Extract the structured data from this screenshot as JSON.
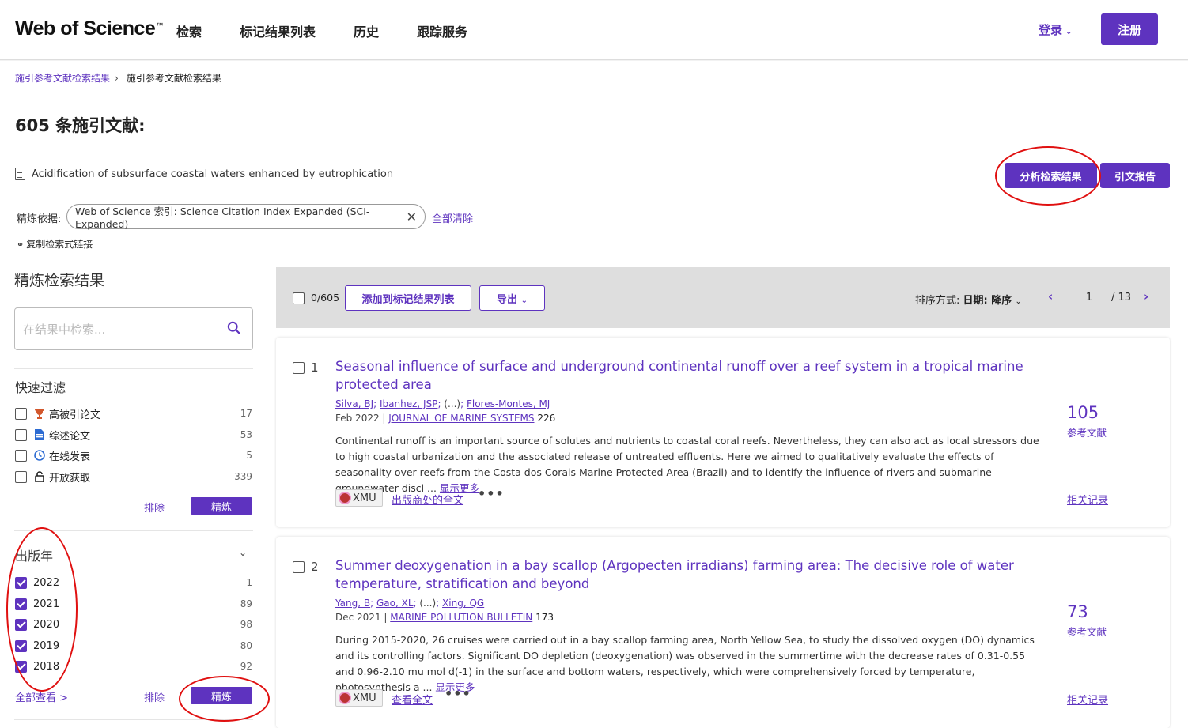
{
  "header": {
    "logo": "Web of Science",
    "logo_tm": "™",
    "nav": [
      "检索",
      "标记结果列表",
      "历史",
      "跟踪服务"
    ],
    "login_label": "登录",
    "register_label": "注册"
  },
  "breadcrumb": {
    "link": "施引参考文献检索结果",
    "current": "施引参考文献检索结果"
  },
  "page_title": "605 条施引文献:",
  "cited_paper": "Acidification of subsurface coastal waters enhanced by eutrophication",
  "actions": {
    "analyze": "分析检索结果",
    "citation_report": "引文报告"
  },
  "refine": {
    "label": "精炼依据:",
    "chip": "Web of Science 索引: Science Citation Index Expanded (SCI-Expanded)",
    "clear_all": "全部清除",
    "copy_link": "复制检索式链接"
  },
  "sidebar": {
    "title": "精炼检索结果",
    "search_placeholder": "在结果中检索...",
    "quick_filter": {
      "title": "快速过滤",
      "items": [
        {
          "label": "高被引论文",
          "count": "17",
          "icon": "trophy-icon"
        },
        {
          "label": "综述论文",
          "count": "53",
          "icon": "document-icon"
        },
        {
          "label": "在线发表",
          "count": "5",
          "icon": "clock-icon"
        },
        {
          "label": "开放获取",
          "count": "339",
          "icon": "lock-icon"
        }
      ],
      "exclude": "排除",
      "refine": "精炼"
    },
    "pub_year": {
      "title": "出版年",
      "items": [
        {
          "label": "2022",
          "count": "1",
          "checked": true
        },
        {
          "label": "2021",
          "count": "89",
          "checked": true
        },
        {
          "label": "2020",
          "count": "98",
          "checked": true
        },
        {
          "label": "2019",
          "count": "80",
          "checked": true
        },
        {
          "label": "2018",
          "count": "92",
          "checked": true
        }
      ],
      "see_all": "全部查看 >",
      "exclude": "排除",
      "refine": "精炼"
    }
  },
  "toolbar": {
    "selected": "0/605",
    "add_to_marked": "添加到标记结果列表",
    "export": "导出",
    "sort_prefix": "排序方式:",
    "sort_value": "日期: 降序",
    "page": "1",
    "total": "/ 13"
  },
  "results": [
    {
      "num": "1",
      "title": "Seasonal influence of surface and underground continental runoff over a reef system in a tropical marine protected area",
      "authors": [
        "Silva, BJ",
        "Ibanhez, JSP",
        "(...)",
        "Flores-Montes, MJ"
      ],
      "date": "Feb 2022",
      "journal": "JOURNAL OF MARINE SYSTEMS",
      "volume": "226",
      "abstract": "Continental runoff is an important source of solutes and nutrients to coastal coral reefs. Nevertheless, they can also act as local stressors due to high coastal urbanization and the associated release of untreated effluents. Here we aimed to qualitatively evaluate the effects of seasonality over reefs from the Costa dos Corais Marine Protected Area (Brazil) and to identify the influence of rivers and submarine groundwater discl ...",
      "show_more": "显示更多",
      "institution": "XMU",
      "fulltext": "出版商处的全文",
      "citations": "105",
      "citations_label": "参考文献",
      "related": "相关记录"
    },
    {
      "num": "2",
      "title": "Summer deoxygenation in a bay scallop (Argopecten irradians) farming area: The decisive role of water temperature, stratification and beyond",
      "authors": [
        "Yang, B",
        "Gao, XL",
        "(...)",
        "Xing, QG"
      ],
      "date": "Dec 2021",
      "journal": "MARINE POLLUTION BULLETIN",
      "volume": "173",
      "abstract": "During 2015-2020, 26 cruises were carried out in a bay scallop farming area, North Yellow Sea, to study the dissolved oxygen (DO) dynamics and its controlling factors. Significant DO depletion (deoxygenation) was observed in the summertime with the decrease rates of 0.31-0.55 and 0.96-2.10 mu mol d(-1) in the surface and bottom waters, respectively, which were comprehensively forced by temperature, photosynthesis a ...",
      "show_more": "显示更多",
      "institution": "XMU",
      "fulltext": "查看全文",
      "citations": "73",
      "citations_label": "参考文献",
      "related": "相关记录"
    }
  ],
  "colors": {
    "accent": "#5e33bf",
    "annotation": "#e01010"
  }
}
